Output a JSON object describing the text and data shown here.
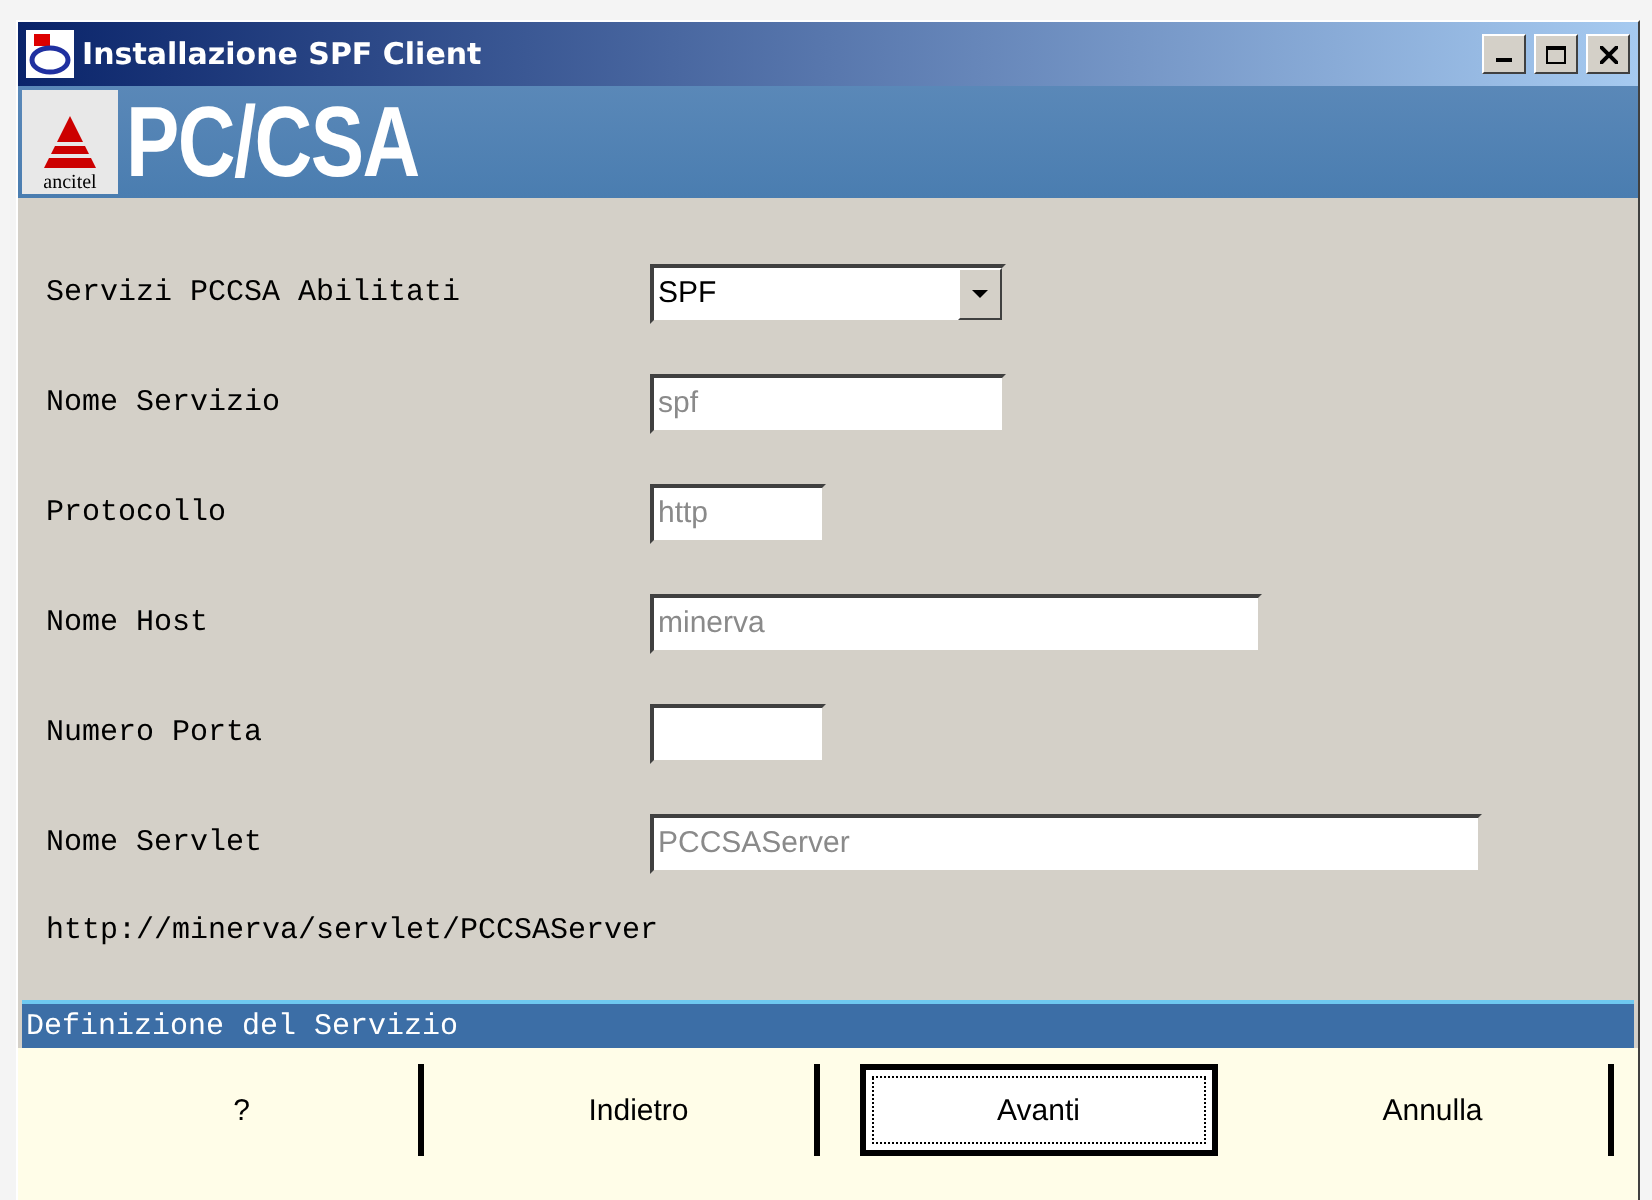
{
  "window": {
    "title": "Installazione SPF Client"
  },
  "banner": {
    "logo_caption": "ancitel",
    "title": "PC/CSA"
  },
  "form": {
    "fields": [
      {
        "kind": "combo",
        "label": "Servizi PCCSA Abilitati",
        "value": "SPF",
        "disabled": false
      },
      {
        "kind": "text",
        "label": "Nome Servizio",
        "value": "spf",
        "disabled": true
      },
      {
        "kind": "text",
        "label": "Protocollo",
        "value": "http",
        "disabled": true
      },
      {
        "kind": "text",
        "label": "Nome Host",
        "value": "minerva",
        "disabled": true
      },
      {
        "kind": "text",
        "label": "Numero Porta"
      },
      {
        "kind": "text",
        "label": "Nome Servlet",
        "value": "PCCSAServer",
        "disabled": true
      }
    ],
    "url": "http://minerva/servlet/PCCSAServer"
  },
  "status_bar": {
    "text": "Definizione del Servizio"
  },
  "buttons": [
    {
      "label": "?",
      "focused": false
    },
    {
      "label": "Indietro",
      "focused": false
    },
    {
      "label": "Avanti",
      "focused": true
    },
    {
      "label": "Annulla",
      "focused": false
    }
  ]
}
